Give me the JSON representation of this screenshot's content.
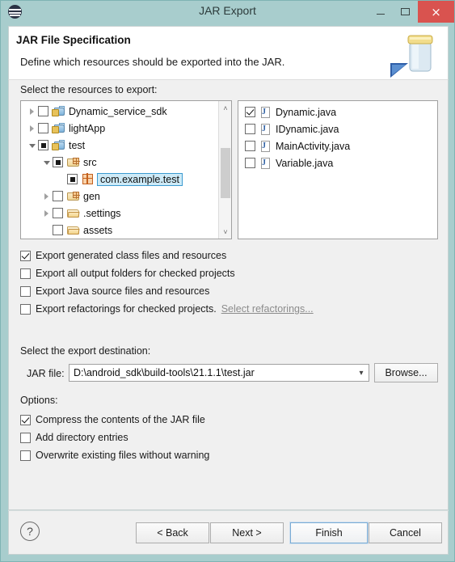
{
  "window": {
    "title": "JAR Export",
    "app_icon": "eclipse-icon",
    "minimize_label": "Minimize",
    "maximize_label": "Maximize",
    "close_label": "×"
  },
  "header": {
    "title": "JAR File Specification",
    "subtitle": "Define which resources should be exported into the JAR.",
    "banner_icon": "jar-export-banner-icon"
  },
  "resources": {
    "label": "Select the resources to export:",
    "tree": [
      {
        "name": "Dynamic_service_sdk",
        "indent": 0,
        "expander": "collapsed",
        "check": "unchecked",
        "icon": "android-project-icon",
        "selected": false
      },
      {
        "name": "lightApp",
        "indent": 0,
        "expander": "collapsed",
        "check": "unchecked",
        "icon": "android-project-icon",
        "selected": false
      },
      {
        "name": "test",
        "indent": 0,
        "expander": "expanded",
        "check": "partial",
        "icon": "android-project-icon",
        "selected": false
      },
      {
        "name": "src",
        "indent": 1,
        "expander": "expanded",
        "check": "partial",
        "icon": "source-folder-icon",
        "selected": false
      },
      {
        "name": "com.example.test",
        "indent": 2,
        "expander": "none",
        "check": "partial",
        "icon": "package-icon",
        "selected": true
      },
      {
        "name": "gen",
        "indent": 1,
        "expander": "collapsed",
        "check": "unchecked",
        "icon": "source-folder-icon",
        "selected": false
      },
      {
        "name": ".settings",
        "indent": 1,
        "expander": "collapsed",
        "check": "unchecked",
        "icon": "folder-icon",
        "selected": false
      },
      {
        "name": "assets",
        "indent": 1,
        "expander": "none",
        "check": "unchecked",
        "icon": "folder-icon",
        "selected": false
      }
    ],
    "files": [
      {
        "name": "Dynamic.java",
        "check": "checked",
        "icon": "java-file-icon"
      },
      {
        "name": "IDynamic.java",
        "check": "unchecked",
        "icon": "java-file-icon"
      },
      {
        "name": "MainActivity.java",
        "check": "unchecked",
        "icon": "java-file-icon"
      },
      {
        "name": "Variable.java",
        "check": "unchecked",
        "icon": "java-file-icon"
      }
    ],
    "scrollbar": {
      "up": "˄",
      "down": "˅"
    }
  },
  "export_options": [
    {
      "label": "Export generated class files and resources",
      "check": "checked"
    },
    {
      "label": "Export all output folders for checked projects",
      "check": "unchecked"
    },
    {
      "label": "Export Java source files and resources",
      "check": "unchecked"
    },
    {
      "label": "Export refactorings for checked projects.",
      "check": "unchecked",
      "link": "Select refactorings..."
    }
  ],
  "destination": {
    "label": "Select the export destination:",
    "field_label": "JAR file:",
    "value": "D:\\android_sdk\\build-tools\\21.1.1\\test.jar",
    "placeholder": "",
    "chevron": "▾",
    "browse_label": "Browse..."
  },
  "options": {
    "label": "Options:",
    "items": [
      {
        "label": "Compress the contents of the JAR file",
        "check": "checked"
      },
      {
        "label": "Add directory entries",
        "check": "unchecked"
      },
      {
        "label": "Overwrite existing files without warning",
        "check": "unchecked"
      }
    ]
  },
  "footer": {
    "help": "?",
    "back": "< Back",
    "next": "Next >",
    "finish": "Finish",
    "cancel": "Cancel"
  },
  "colors": {
    "titlebar": "#a8cdcd",
    "close_button": "#d9534f",
    "selection": "#cdeaf7",
    "selection_border": "#3c9bd0",
    "focus_border": "#7aabd4",
    "panel": "#f0f0f0"
  }
}
